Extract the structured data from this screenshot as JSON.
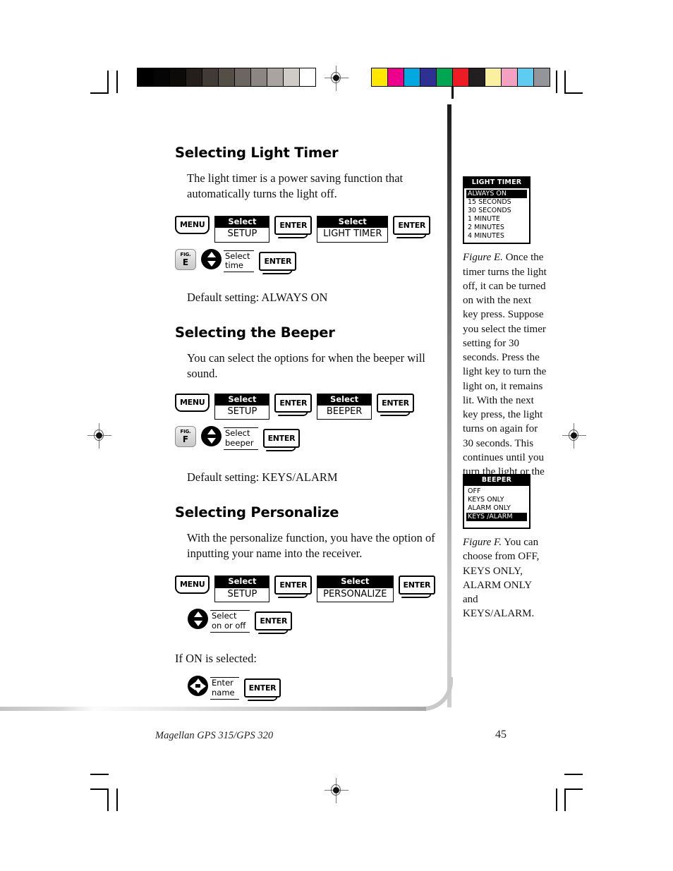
{
  "page": {
    "footer_title": "Magellan GPS 315/GPS 320",
    "page_number": "45"
  },
  "sections": [
    {
      "heading": "Selecting Light Timer",
      "body": "The light timer is a power saving function that automatically turns the light off.",
      "default_setting": "Default setting:  ALWAYS ON",
      "steps_row1": {
        "menu_key": "MENU",
        "box1_head": "Select",
        "box1_value": "SETUP",
        "enter1": "ENTER",
        "box2_head": "Select",
        "box2_value": "LIGHT TIMER",
        "enter2": "ENTER"
      },
      "steps_row2": {
        "fig_tag_top": "FIG.",
        "fig_tag_letter": "E",
        "pad_label_line1": "Select",
        "pad_label_line2": "time",
        "enter": "ENTER"
      }
    },
    {
      "heading": "Selecting the Beeper",
      "body": "You can select the options for when the beeper will sound.",
      "default_setting": "Default setting:  KEYS/ALARM",
      "steps_row1": {
        "menu_key": "MENU",
        "box1_head": "Select",
        "box1_value": "SETUP",
        "enter1": "ENTER",
        "box2_head": "Select",
        "box2_value": "BEEPER",
        "enter2": "ENTER"
      },
      "steps_row2": {
        "fig_tag_top": "FIG.",
        "fig_tag_letter": "F",
        "pad_label_line1": "Select",
        "pad_label_line2": "beeper",
        "enter": "ENTER"
      }
    },
    {
      "heading": "Selecting Personalize",
      "body": "With the personalize function, you have the option of inputting your name into the receiver.",
      "conditional_text": "If ON is selected:",
      "steps_row1": {
        "menu_key": "MENU",
        "box1_head": "Select",
        "box1_value": "SETUP",
        "enter1": "ENTER",
        "box2_head": "Select",
        "box2_value": "PERSONALIZE",
        "enter2": "ENTER"
      },
      "steps_row2": {
        "pad_label_line1": "Select",
        "pad_label_line2": "on or off",
        "enter": "ENTER"
      },
      "steps_row3": {
        "pad_label_line1": "Enter",
        "pad_label_line2": "name",
        "enter": "ENTER"
      }
    }
  ],
  "figures": [
    {
      "lcd_title": "LIGHT TIMER",
      "lcd_items": [
        {
          "label": "ALWAYS ON",
          "selected": true
        },
        {
          "label": "15 SECONDS",
          "selected": false
        },
        {
          "label": "30 SECONDS",
          "selected": false
        },
        {
          "label": "1 MINUTE",
          "selected": false
        },
        {
          "label": "2 MINUTES",
          "selected": false
        },
        {
          "label": "4 MINUTES",
          "selected": false
        }
      ],
      "caption_label": "Figure E.",
      "caption_text": "  Once the timer turns the light off, it can be turned on with the next key press.  Suppose you select the timer setting for 30 seconds.  Press the light key to turn the light on, it remains lit.  With the next key press, the light turns on again for 30 seconds.  This continues until you turn the light or the receiver off."
    },
    {
      "lcd_title": "BEEPER",
      "lcd_items": [
        {
          "label": "OFF",
          "selected": false
        },
        {
          "label": "KEYS ONLY",
          "selected": false
        },
        {
          "label": "ALARM ONLY",
          "selected": false
        },
        {
          "label": "KEYS /ALARM",
          "selected": true
        }
      ],
      "caption_label": "Figure F.",
      "caption_text": "  You can choose from OFF, KEYS ONLY, ALARM ONLY and KEYS/ALARM."
    }
  ],
  "calibration": {
    "grayscale_bar": [
      "#000000",
      "#050505",
      "#0d0b08",
      "#241f1b",
      "#423b35",
      "#554e47",
      "#6d6660",
      "#8c8680",
      "#aaa49e",
      "#cfcbc7",
      "#ffffff"
    ],
    "color_bar": [
      "#ffe700",
      "#ec008c",
      "#00a9e0",
      "#2e3192",
      "#00a651",
      "#ed1c24",
      "#231f20",
      "#fbefa0",
      "#f4a0c0",
      "#5ecbf0",
      "#939598"
    ]
  }
}
